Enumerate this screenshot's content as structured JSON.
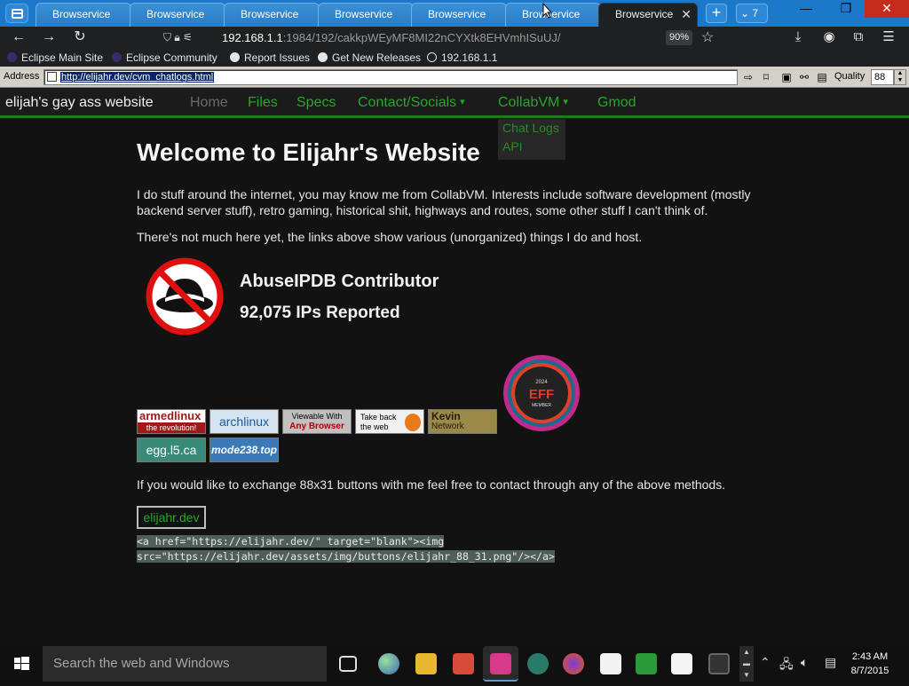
{
  "browser": {
    "tabs": [
      "Browservice",
      "Browservice",
      "Browservice",
      "Browservice",
      "Browservice",
      "Browservice",
      "Browservice"
    ],
    "active_tab_index": 6,
    "tab_count": "7",
    "url_host": "192.168.1.1",
    "url_path": ":1984/192/cakkpWEyMF8MI22nCYXtk8EHVmhISuUJ/",
    "zoom": "90%",
    "bookmarks": [
      {
        "label": "Eclipse Main Site",
        "icon": "eclipse-icon"
      },
      {
        "label": "Eclipse Community",
        "icon": "eclipse-icon"
      },
      {
        "label": "Report Issues",
        "icon": "github-icon"
      },
      {
        "label": "Get New Releases",
        "icon": "github-icon"
      },
      {
        "label": "192.168.1.1",
        "icon": "globe-icon"
      }
    ]
  },
  "retro_bar": {
    "address_label": "Address",
    "address_value": "http://elijahr.dev/cvm_chatlogs.html",
    "quality_label": "Quality",
    "quality_value": "88"
  },
  "site": {
    "brand": "elijah's gay ass website",
    "nav": [
      "Home",
      "Files",
      "Specs",
      "Contact/Socials",
      "CollabVM",
      "Gmod"
    ],
    "dropdown": [
      "Chat Logs",
      "API"
    ],
    "title": "Welcome to Elijahr's Website",
    "para1": "I do stuff around the internet, you may know me from CollabVM. Interests include software development (mostly backend server stuff), retro gaming, historical shit, highways and routes, some other stuff I can't think of.",
    "para2": "There's not much here yet, the links above show various (unorganized) things I do and host.",
    "abuse_title": "AbuseIPDB Contributor",
    "abuse_count": "92,075 IPs Reported",
    "eff_year": "2024",
    "eff_label": "EFF",
    "eff_member": "MEMBER",
    "buttons": [
      {
        "line1": "armedlinux",
        "line2": "the revolution!"
      },
      {
        "line1": "archlinux",
        "line2": ""
      },
      {
        "line1": "Viewable With",
        "line2": "Any Browser"
      },
      {
        "line1": "Take back",
        "line2": "the web"
      },
      {
        "line1": "Kevin",
        "line2": "Network"
      },
      {
        "line1": "egg.l5.ca",
        "line2": ""
      },
      {
        "line1": "mode238.top",
        "line2": ""
      }
    ],
    "exchange_text": "If you would like to exchange 88x31 buttons with me feel free to contact through any of the above methods.",
    "own_button": "elijahr.dev",
    "code_line1": "<a href=\"https://elijahr.dev/\" target=\"blank\"><img",
    "code_line2": "src=\"https://elijahr.dev/assets/img/buttons/elijahr_88_31.png\"/></a>"
  },
  "taskbar": {
    "search_placeholder": "Search the web and Windows",
    "time": "2:43 AM",
    "date": "8/7/2015"
  },
  "colors": {
    "accent_green": "#2aa52a",
    "tab_blue": "#1c78c8",
    "page_bg": "#121212"
  }
}
